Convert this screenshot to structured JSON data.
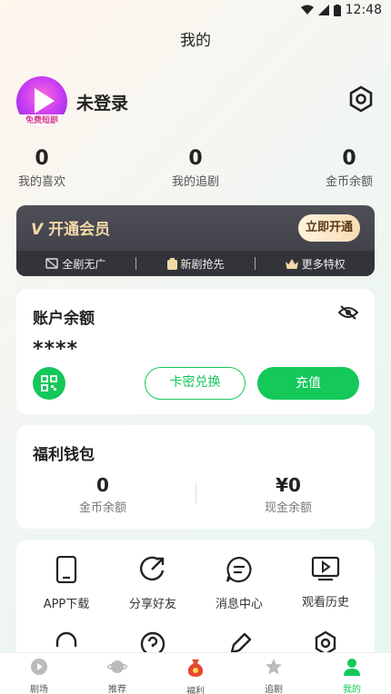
{
  "status": {
    "time": "12:48"
  },
  "header": {
    "title": "我的"
  },
  "profile": {
    "avatar_text": "免费短剧",
    "username": "未登录"
  },
  "stats": [
    {
      "value": "0",
      "label": "我的喜欢"
    },
    {
      "value": "0",
      "label": "我的追剧"
    },
    {
      "value": "0",
      "label": "金币余额"
    }
  ],
  "vip": {
    "title": "开通会员",
    "button": "立即开通",
    "perks": [
      "全剧无广",
      "新剧抢先",
      "更多特权"
    ]
  },
  "balance": {
    "title": "账户余额",
    "masked": "****",
    "redeem": "卡密兑换",
    "recharge": "充值"
  },
  "wallet": {
    "title": "福利钱包",
    "coins_value": "0",
    "coins_label": "金币余额",
    "cash_value": "¥0",
    "cash_label": "现金余额"
  },
  "tools": [
    {
      "label": "APP下载",
      "icon": "phone-icon"
    },
    {
      "label": "分享好友",
      "icon": "share-icon"
    },
    {
      "label": "消息中心",
      "icon": "message-icon"
    },
    {
      "label": "观看历史",
      "icon": "history-icon"
    }
  ],
  "tabs": [
    {
      "label": "剧场",
      "icon": "play-icon"
    },
    {
      "label": "推荐",
      "icon": "planet-icon"
    },
    {
      "label": "福利",
      "icon": "money-bag-icon"
    },
    {
      "label": "追剧",
      "icon": "star-icon"
    },
    {
      "label": "我的",
      "icon": "user-icon"
    }
  ],
  "colors": {
    "accent": "#14c85a",
    "vip_gold": "#f3d9a8"
  }
}
